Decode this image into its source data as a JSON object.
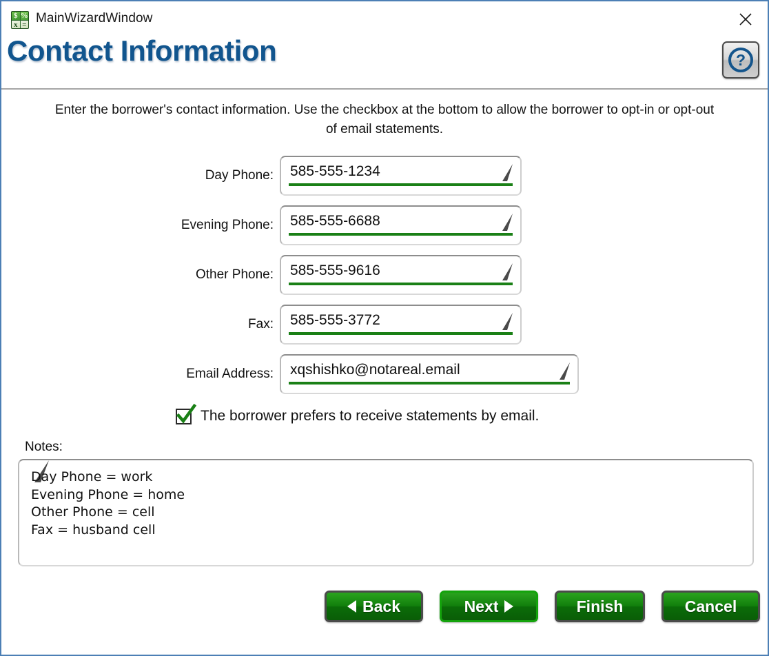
{
  "window": {
    "title": "MainWizardWindow",
    "app_icon": "spreadsheet-calculator-icon",
    "icon_glyphs": [
      "$",
      "%",
      "x",
      "="
    ],
    "close_icon": "close-icon",
    "border_color": "#4c7fb5"
  },
  "header": {
    "page_title": "Contact Information",
    "title_color": "#11558e",
    "help_icon": "?",
    "help_name": "help-button"
  },
  "instructions": "Enter the borrower's contact information. Use the checkbox at the bottom to allow the borrower to opt-in or opt-out of email statements.",
  "fields": [
    {
      "label": "Day Phone:",
      "value": "585-555-1234",
      "name": "day-phone"
    },
    {
      "label": "Evening Phone:",
      "value": "585-555-6688",
      "name": "evening-phone"
    },
    {
      "label": "Other Phone:",
      "value": "585-555-9616",
      "name": "other-phone"
    },
    {
      "label": "Fax:",
      "value": "585-555-3772",
      "name": "fax"
    },
    {
      "label": "Email Address:",
      "value": "xqshishko@notareal.email",
      "name": "email-address"
    }
  ],
  "checkbox": {
    "label": "The borrower prefers to receive statements by email.",
    "checked": true,
    "check_color": "#1a8016"
  },
  "notes": {
    "label": "Notes:",
    "value": "Day Phone = work\nEvening Phone = home\nOther Phone = cell\nFax = husband cell"
  },
  "buttons": {
    "back": "Back",
    "next": "Next",
    "finish": "Finish",
    "cancel": "Cancel"
  },
  "colors": {
    "accent_green": "#1a8016",
    "button_green_top": "#2aa31f",
    "button_green_bottom": "#0a5d07",
    "primary_border": "#14a30c",
    "default_border": "#4b4b4b"
  }
}
